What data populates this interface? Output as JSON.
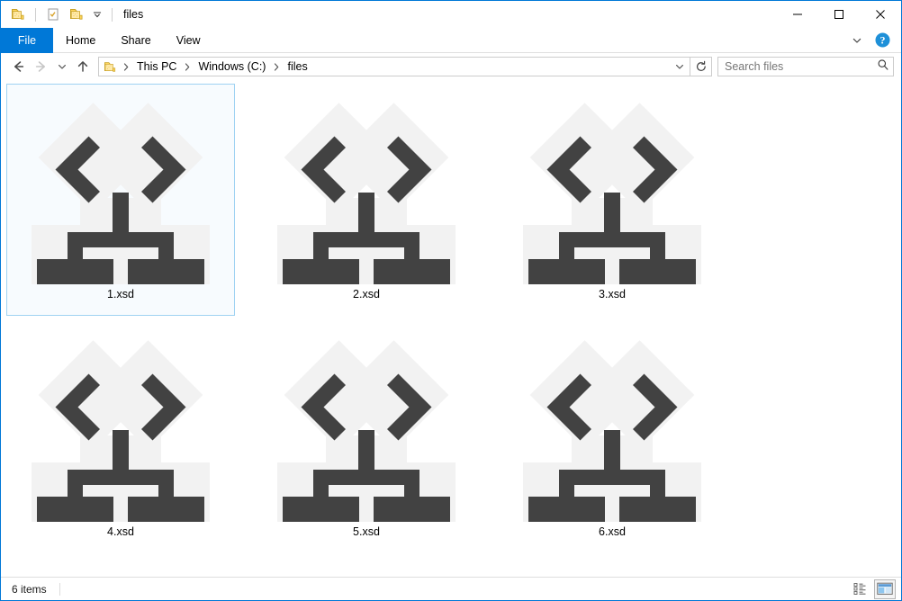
{
  "window": {
    "title": "files",
    "quick_access": [
      {
        "name": "folder-icon",
        "label": "Folder"
      },
      {
        "name": "properties-icon",
        "label": "Properties"
      },
      {
        "name": "new-folder-icon",
        "label": "New folder"
      },
      {
        "name": "chevron-down-icon",
        "label": "Customize Quick Access Toolbar"
      }
    ],
    "controls": {
      "minimize": "—",
      "maximize": "☐",
      "close": "✕"
    },
    "colors": {
      "accent": "#0078d7",
      "selection_border": "#9fd2f2",
      "selection_fill": "#f7fbfe",
      "icon_dark": "#424242",
      "icon_light": "#f2f2f2",
      "folder_yellow": "#ffd54f"
    }
  },
  "ribbon": {
    "tabs": [
      {
        "label": "File",
        "active": true
      },
      {
        "label": "Home",
        "active": false
      },
      {
        "label": "Share",
        "active": false
      },
      {
        "label": "View",
        "active": false
      }
    ],
    "minimize_ribbon": "chevron-down-icon",
    "help": "help-icon"
  },
  "navigation": {
    "back": "back-arrow-icon",
    "forward": "forward-arrow-icon",
    "recent": "chevron-down-icon",
    "up": "up-arrow-icon",
    "breadcrumb": [
      "This PC",
      "Windows (C:)",
      "files"
    ],
    "breadcrumb_separator": "›",
    "address_dropdown": "chevron-down-icon",
    "refresh": "refresh-icon"
  },
  "search": {
    "placeholder": "Search files",
    "value": "",
    "icon": "search-icon"
  },
  "files": [
    {
      "name": "1.xsd",
      "type": "xsd",
      "selected": true
    },
    {
      "name": "2.xsd",
      "type": "xsd",
      "selected": false
    },
    {
      "name": "3.xsd",
      "type": "xsd",
      "selected": false
    },
    {
      "name": "4.xsd",
      "type": "xsd",
      "selected": false
    },
    {
      "name": "5.xsd",
      "type": "xsd",
      "selected": false
    },
    {
      "name": "6.xsd",
      "type": "xsd",
      "selected": false
    }
  ],
  "status": {
    "item_count": "6 items",
    "views": [
      {
        "name": "details-view-button",
        "active": false
      },
      {
        "name": "large-icons-view-button",
        "active": true
      }
    ]
  }
}
